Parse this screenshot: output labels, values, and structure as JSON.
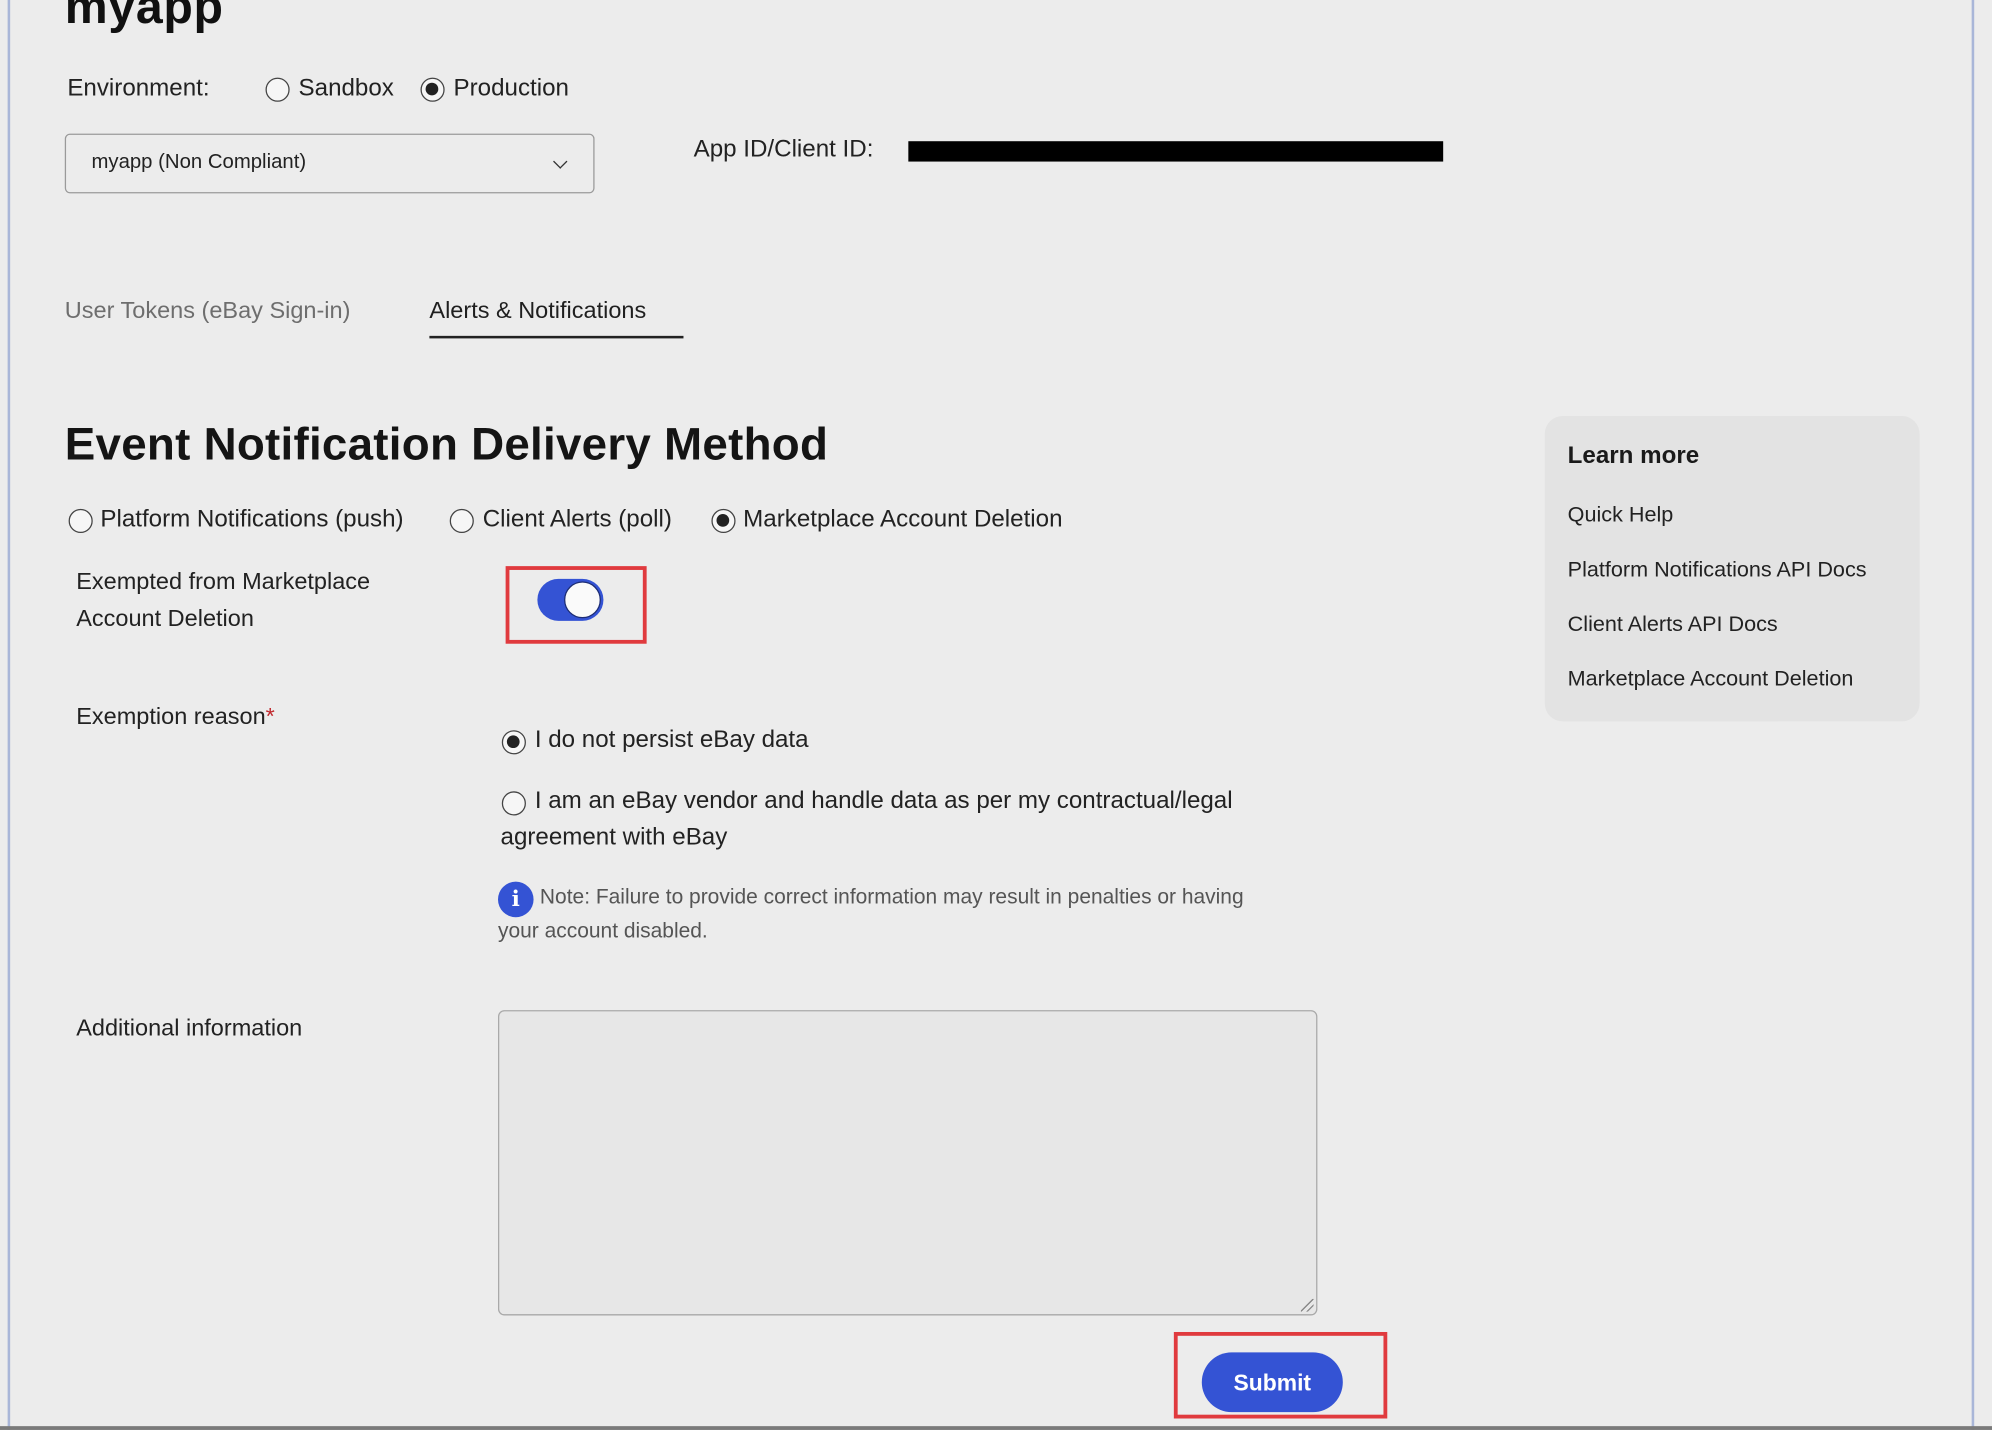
{
  "header": {
    "app_title": "myapp",
    "environment_label": "Environment:",
    "environments": [
      {
        "label": "Sandbox",
        "selected": false
      },
      {
        "label": "Production",
        "selected": true
      }
    ],
    "app_select_value": "myapp (Non Compliant)",
    "app_id_label": "App ID/Client ID:"
  },
  "tabs": [
    {
      "label": "User Tokens (eBay Sign-in)",
      "active": false
    },
    {
      "label": "Alerts & Notifications",
      "active": true
    }
  ],
  "main": {
    "section_title": "Event Notification Delivery Method",
    "delivery_methods": [
      {
        "label": "Platform Notifications (push)",
        "selected": false
      },
      {
        "label": "Client Alerts (poll)",
        "selected": false
      },
      {
        "label": "Marketplace Account Deletion",
        "selected": true
      }
    ],
    "exempted_label_line1": "Exempted from Marketplace",
    "exempted_label_line2": "Account Deletion",
    "exempted_toggle_on": true,
    "exemption_reason_label": "Exemption reason",
    "required_mark": "*",
    "reasons": [
      {
        "label": "I do not persist eBay data",
        "selected": true
      },
      {
        "label_line1": "I am an eBay vendor and handle data as per my contractual/legal",
        "label_line2": "agreement with eBay",
        "selected": false
      }
    ],
    "note_icon": "i",
    "note_text": "Note: Failure to provide correct information may result in penalties or having your account disabled.",
    "additional_info_label": "Additional information",
    "additional_info_value": "",
    "submit_label": "Submit"
  },
  "learn_more": {
    "title": "Learn more",
    "links": [
      "Quick Help",
      "Platform Notifications API Docs",
      "Client Alerts API Docs",
      "Marketplace Account Deletion"
    ]
  },
  "colors": {
    "accent": "#3453d4",
    "highlight": "#e03a3e",
    "background": "#ececec"
  }
}
